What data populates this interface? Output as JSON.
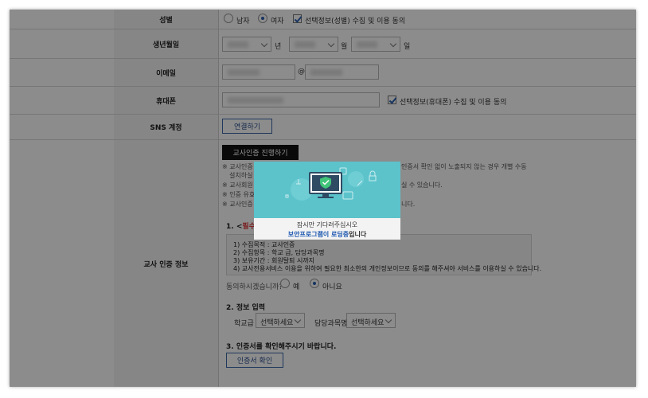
{
  "form": {
    "gender": {
      "label": "성별",
      "male": "남자",
      "female": "여자",
      "selected": "여자",
      "consent": "선택정보(성별) 수집 및 이용 동의"
    },
    "birthday": {
      "label": "생년월일",
      "year_suffix": "년",
      "month_suffix": "월",
      "day_suffix": "일"
    },
    "email": {
      "label": "이메일",
      "at": "@"
    },
    "phone": {
      "label": "휴대폰",
      "consent": "선택정보(휴대폰) 수집 및 이용 동의"
    },
    "sns": {
      "label": "SNS 계정",
      "button": "연결하기"
    },
    "teacher": {
      "label": "교사 인증 정보",
      "button": "교사인증 진행하기",
      "notes": [
        "※ 교사인증",
        "인증서 확인 없이 노출되지 않는 경우 개별 수동",
        "설치하실 수",
        "※ 교사회원",
        "실 수 있습니다.",
        "※ 인증 유효",
        "※ 교사인증",
        "니다."
      ],
      "required_prefix": "1. <",
      "required_word": "필수",
      "required_suffix": ">",
      "terms": [
        "1) 수집목적 : 교사인증",
        "2) 수집항목 : 학교 급, 담당과목명",
        "3) 보유기간 : 회원탈퇴 시까지",
        "4) 교사전용서비스 이용을 위하여 필요한 최소한의 개인정보이므로 동의를 해주셔야 서비스를 이용하실 수 있습니다."
      ],
      "agree_question": "동의하시겠습니까?",
      "agree_yes": "예",
      "agree_no": "아니요",
      "agree_selected": "아니요",
      "section2": "2. 정보 입력",
      "school_level_label": "학교급",
      "school_level_value": "선택하세요",
      "subject_label": "담당과목명",
      "subject_value": "선택하세요",
      "section3": "3. 인증서를 확인해주시기 바랍니다.",
      "cert_button": "인증서 확인"
    }
  },
  "modal": {
    "line1": "잠시만 기다려주십시오",
    "line2_highlight": "보안프로그램이 로딩중",
    "line2_suffix": "입니다",
    "illustration": "monitor-shield-icon"
  },
  "colors": {
    "accent": "#2a5fb0",
    "modal_bg": "#5cc3cb",
    "overlay": "#000000"
  }
}
